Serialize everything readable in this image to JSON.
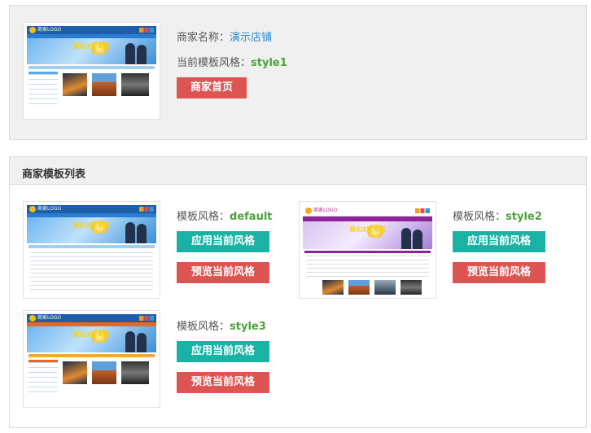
{
  "merchant": {
    "name_label": "商家名称：",
    "name_value": "演示店铺",
    "style_label": "当前模板风格：",
    "style_value": "style1",
    "home_button": "商家首页",
    "preview_logo_text": "商家LOGO",
    "preview_banner_text": "锦光决策 财富"
  },
  "template_list": {
    "title": "商家模板列表",
    "style_label": "模板风格：",
    "apply_button": "应用当前风格",
    "preview_button": "预览当前风格",
    "items": [
      {
        "style": "default",
        "logo_text": "商家LOGO",
        "banner_text": "锦光决策 财富"
      },
      {
        "style": "style2",
        "logo_text": "商家LOGO",
        "banner_text": "锦光决策 财富"
      },
      {
        "style": "style3",
        "logo_text": "商家LOGO",
        "banner_text": "锦光决策 财富"
      }
    ]
  },
  "colors": {
    "red_button": "#dc5553",
    "teal_button": "#1bb2a6",
    "link": "#2a8bd3",
    "style_value": "#4aa43a"
  }
}
